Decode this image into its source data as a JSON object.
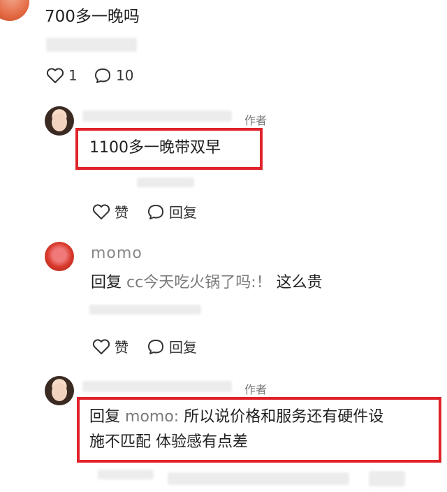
{
  "top_comment": {
    "text": "700多一晚吗",
    "like_count": "1",
    "reply_count": "10"
  },
  "reply1": {
    "author_tag": "作者",
    "text": "1100多一晚带双早",
    "like_label": "赞",
    "reply_label": "回复"
  },
  "reply2": {
    "username": "momo",
    "prefix": "回复",
    "mention": "cc今天吃火锅了吗:！",
    "text": "这么贵",
    "like_label": "赞",
    "reply_label": "回复"
  },
  "reply3": {
    "author_tag": "作者",
    "prefix": "回复",
    "mention": "momo:",
    "text_line1": "所以说价格和服务还有硬件设",
    "text_line2": "施不匹配 体验感有点差"
  },
  "colors": {
    "highlight_border": "#e0222a",
    "text": "#1f1f1f",
    "muted": "#777777"
  }
}
